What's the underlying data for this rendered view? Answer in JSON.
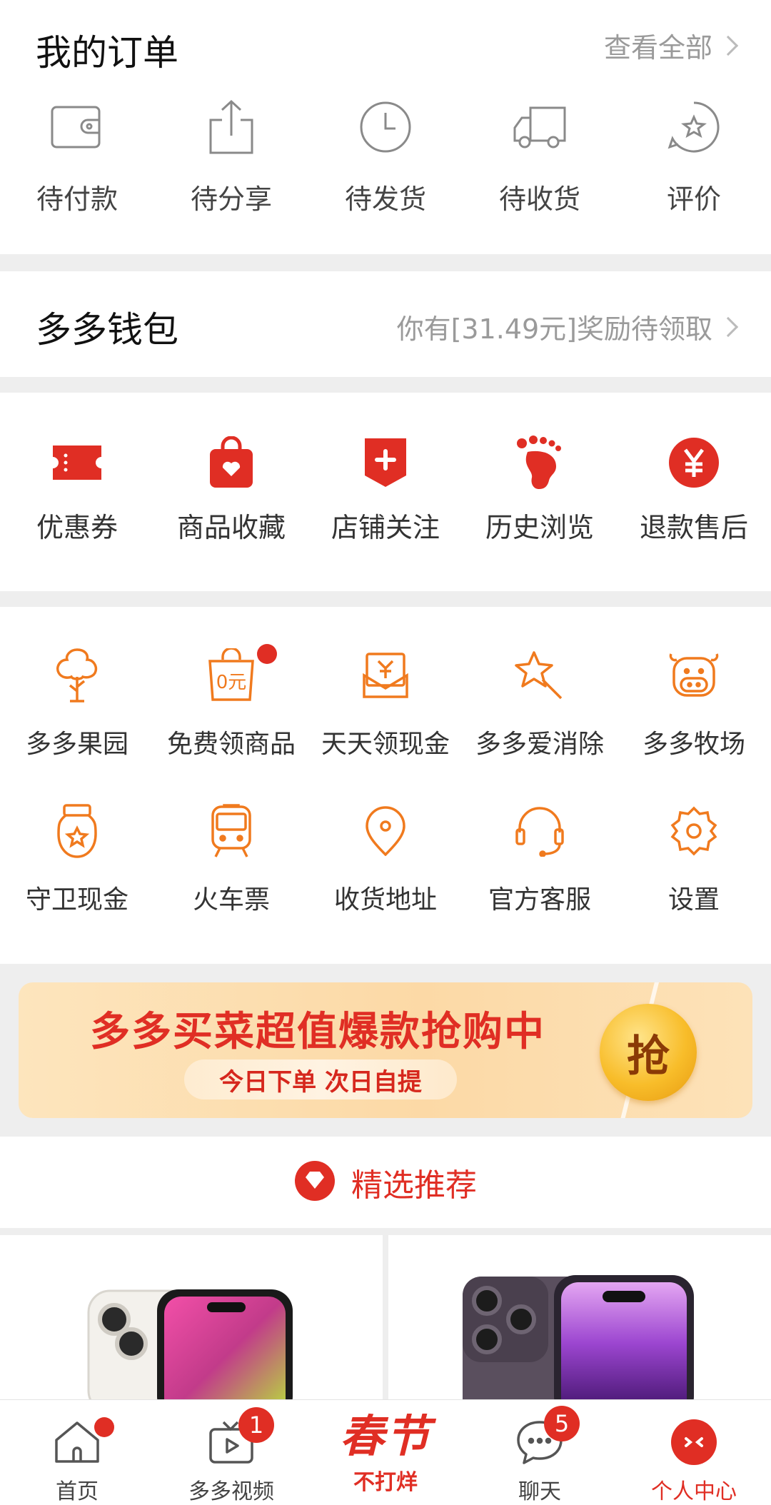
{
  "orders": {
    "title": "我的订单",
    "view_all": "查看全部",
    "items": [
      {
        "label": "待付款",
        "icon": "wallet-icon"
      },
      {
        "label": "待分享",
        "icon": "share-icon"
      },
      {
        "label": "待发货",
        "icon": "clock-icon"
      },
      {
        "label": "待收货",
        "icon": "truck-icon"
      },
      {
        "label": "评价",
        "icon": "star-bubble-icon"
      }
    ]
  },
  "wallet": {
    "title": "多多钱包",
    "link": "你有[31.49元]奖励待领取"
  },
  "shortcuts": {
    "items": [
      {
        "label": "优惠券",
        "icon": "coupon-icon"
      },
      {
        "label": "商品收藏",
        "icon": "bag-heart-icon"
      },
      {
        "label": "店铺关注",
        "icon": "shop-plus-icon"
      },
      {
        "label": "历史浏览",
        "icon": "footprint-icon"
      },
      {
        "label": "退款售后",
        "icon": "yen-circle-icon"
      }
    ]
  },
  "services": {
    "row1": [
      {
        "label": "多多果园",
        "icon": "tree-icon"
      },
      {
        "label": "免费领商品",
        "icon": "free-bag-icon",
        "bag_text": "0元"
      },
      {
        "label": "天天领现金",
        "icon": "cash-envelope-icon"
      },
      {
        "label": "多多爱消除",
        "icon": "star-wand-icon"
      },
      {
        "label": "多多牧场",
        "icon": "cow-icon"
      }
    ],
    "row2": [
      {
        "label": "守卫现金",
        "icon": "jar-star-icon"
      },
      {
        "label": "火车票",
        "icon": "train-icon"
      },
      {
        "label": "收货地址",
        "icon": "location-pin-icon"
      },
      {
        "label": "官方客服",
        "icon": "headset-icon"
      },
      {
        "label": "设置",
        "icon": "gear-icon"
      }
    ]
  },
  "banner": {
    "title": "多多买菜超值爆款抢购中",
    "subtitle": "今日下单 次日自提",
    "coin": "抢"
  },
  "recommend": {
    "title": "精选推荐"
  },
  "tabbar": {
    "items": [
      {
        "label": "首页",
        "icon": "home-icon"
      },
      {
        "label": "多多视频",
        "icon": "video-icon",
        "badge": "1"
      },
      {
        "label": "不打烊",
        "icon": "spring-festival-logo",
        "logo": "春节"
      },
      {
        "label": "聊天",
        "icon": "chat-icon",
        "badge": "5"
      },
      {
        "label": "个人中心",
        "icon": "profile-icon"
      }
    ]
  },
  "colors": {
    "accent": "#e02e24",
    "orange": "#f07a1e",
    "muted": "#9a9a9a"
  }
}
